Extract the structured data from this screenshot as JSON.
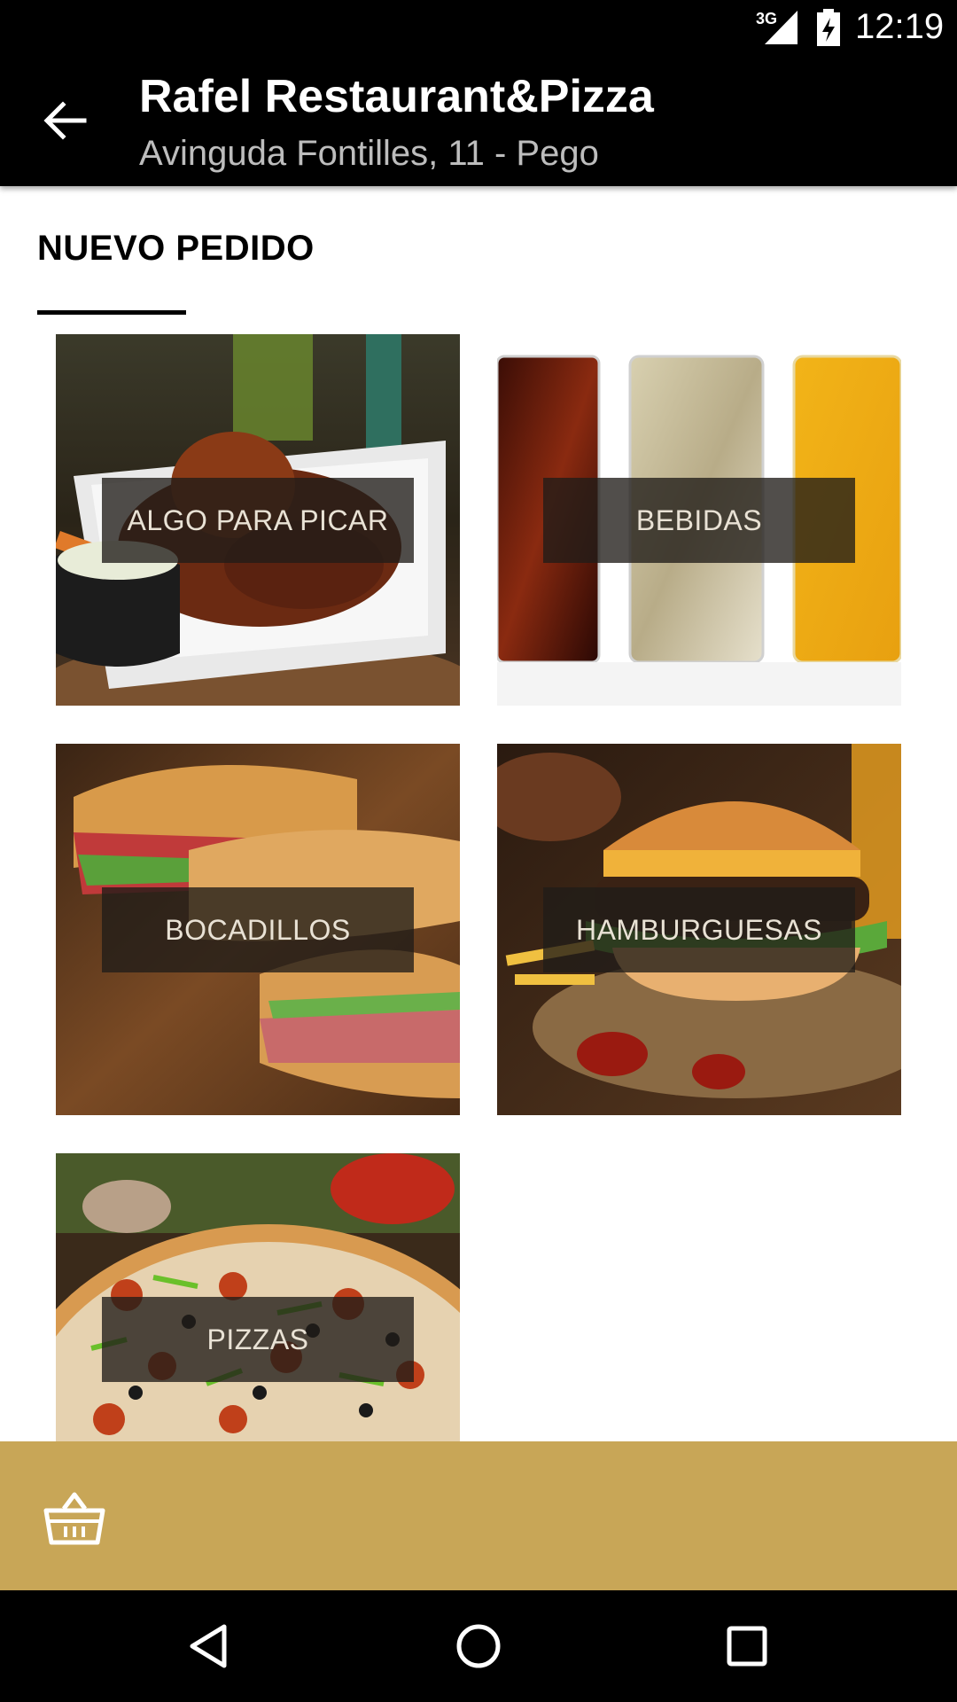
{
  "status_bar": {
    "network": "3G",
    "time": "12:19"
  },
  "app_bar": {
    "title": "Rafel Restaurant&Pizza",
    "subtitle": "Avinguda Fontilles, 11 - Pego"
  },
  "section": {
    "title": "NUEVO PEDIDO"
  },
  "categories": [
    {
      "label": "ALGO PARA PICAR"
    },
    {
      "label": "BEBIDAS"
    },
    {
      "label": "BOCADILLOS"
    },
    {
      "label": "HAMBURGUESAS"
    },
    {
      "label": "PIZZAS"
    }
  ],
  "colors": {
    "accent": "#c8a657",
    "app_bar": "#000000"
  },
  "icons": [
    "back-arrow-icon",
    "basket-icon",
    "nav-back-icon",
    "nav-home-icon",
    "nav-recents-icon"
  ]
}
